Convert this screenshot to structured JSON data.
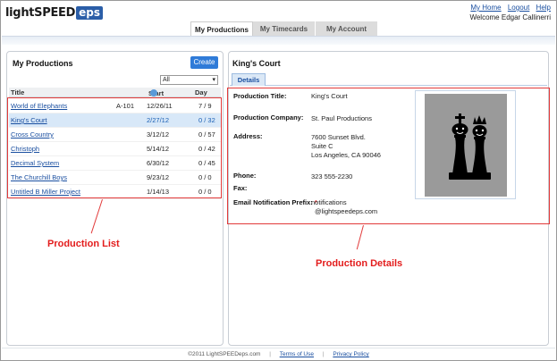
{
  "header": {
    "logo_text": "lightSPEED",
    "logo_box": "eps",
    "links": [
      "My Home",
      "Logout",
      "Help"
    ],
    "welcome": "Welcome  Edgar Callinerri"
  },
  "tabs": [
    {
      "label": "My Productions",
      "active": true
    },
    {
      "label": "My Timecards",
      "active": false
    },
    {
      "label": "My Account",
      "active": false
    }
  ],
  "productions": {
    "title": "My Productions",
    "create_label": "Create",
    "filter_value": "All",
    "columns": {
      "title": "Title",
      "start": "Start",
      "day": "Day"
    },
    "rows": [
      {
        "title": "World of Elephants",
        "code": "A-101",
        "start": "12/26/11",
        "day": "7 / 9",
        "selected": false
      },
      {
        "title": "King's Court",
        "code": "",
        "start": "2/27/12",
        "day": "0 / 32",
        "selected": true
      },
      {
        "title": "Cross Country",
        "code": "",
        "start": "3/12/12",
        "day": "0 / 57",
        "selected": false
      },
      {
        "title": "Christoph",
        "code": "",
        "start": "5/14/12",
        "day": "0 / 42",
        "selected": false
      },
      {
        "title": "Decimal System",
        "code": "",
        "start": "6/30/12",
        "day": "0 / 45",
        "selected": false
      },
      {
        "title": "The Churchill Boys",
        "code": "",
        "start": "9/23/12",
        "day": "0 / 0",
        "selected": false
      },
      {
        "title": "Untitled B Miller Project",
        "code": "",
        "start": "1/14/13",
        "day": "0 / 0",
        "selected": false
      }
    ]
  },
  "details": {
    "title": "King's Court",
    "tab_label": "Details",
    "production_title_label": "Production Title:",
    "production_title": "King's Court",
    "company_label": "Production Company:",
    "company": "St. Paul Productions",
    "address_label": "Address:",
    "address_line1": "7600 Sunset Blvd.",
    "address_line2": "Suite C",
    "address_line3": "Los Angeles, CA 90046",
    "phone_label": "Phone:",
    "phone": "323 555-2230",
    "fax_label": "Fax:",
    "email_label": "Email Notification Prefix:",
    "required_mark": "*",
    "email_line1": "notifications",
    "email_line2": "@lightspeedeps.com"
  },
  "annotations": {
    "list_label": "Production List",
    "details_label": "Production Details",
    "color": "#e31c1c"
  },
  "footer": {
    "copyright": "©2011 LightSPEEDeps.com",
    "terms": "Terms of Use",
    "privacy": "Privacy Policy"
  }
}
